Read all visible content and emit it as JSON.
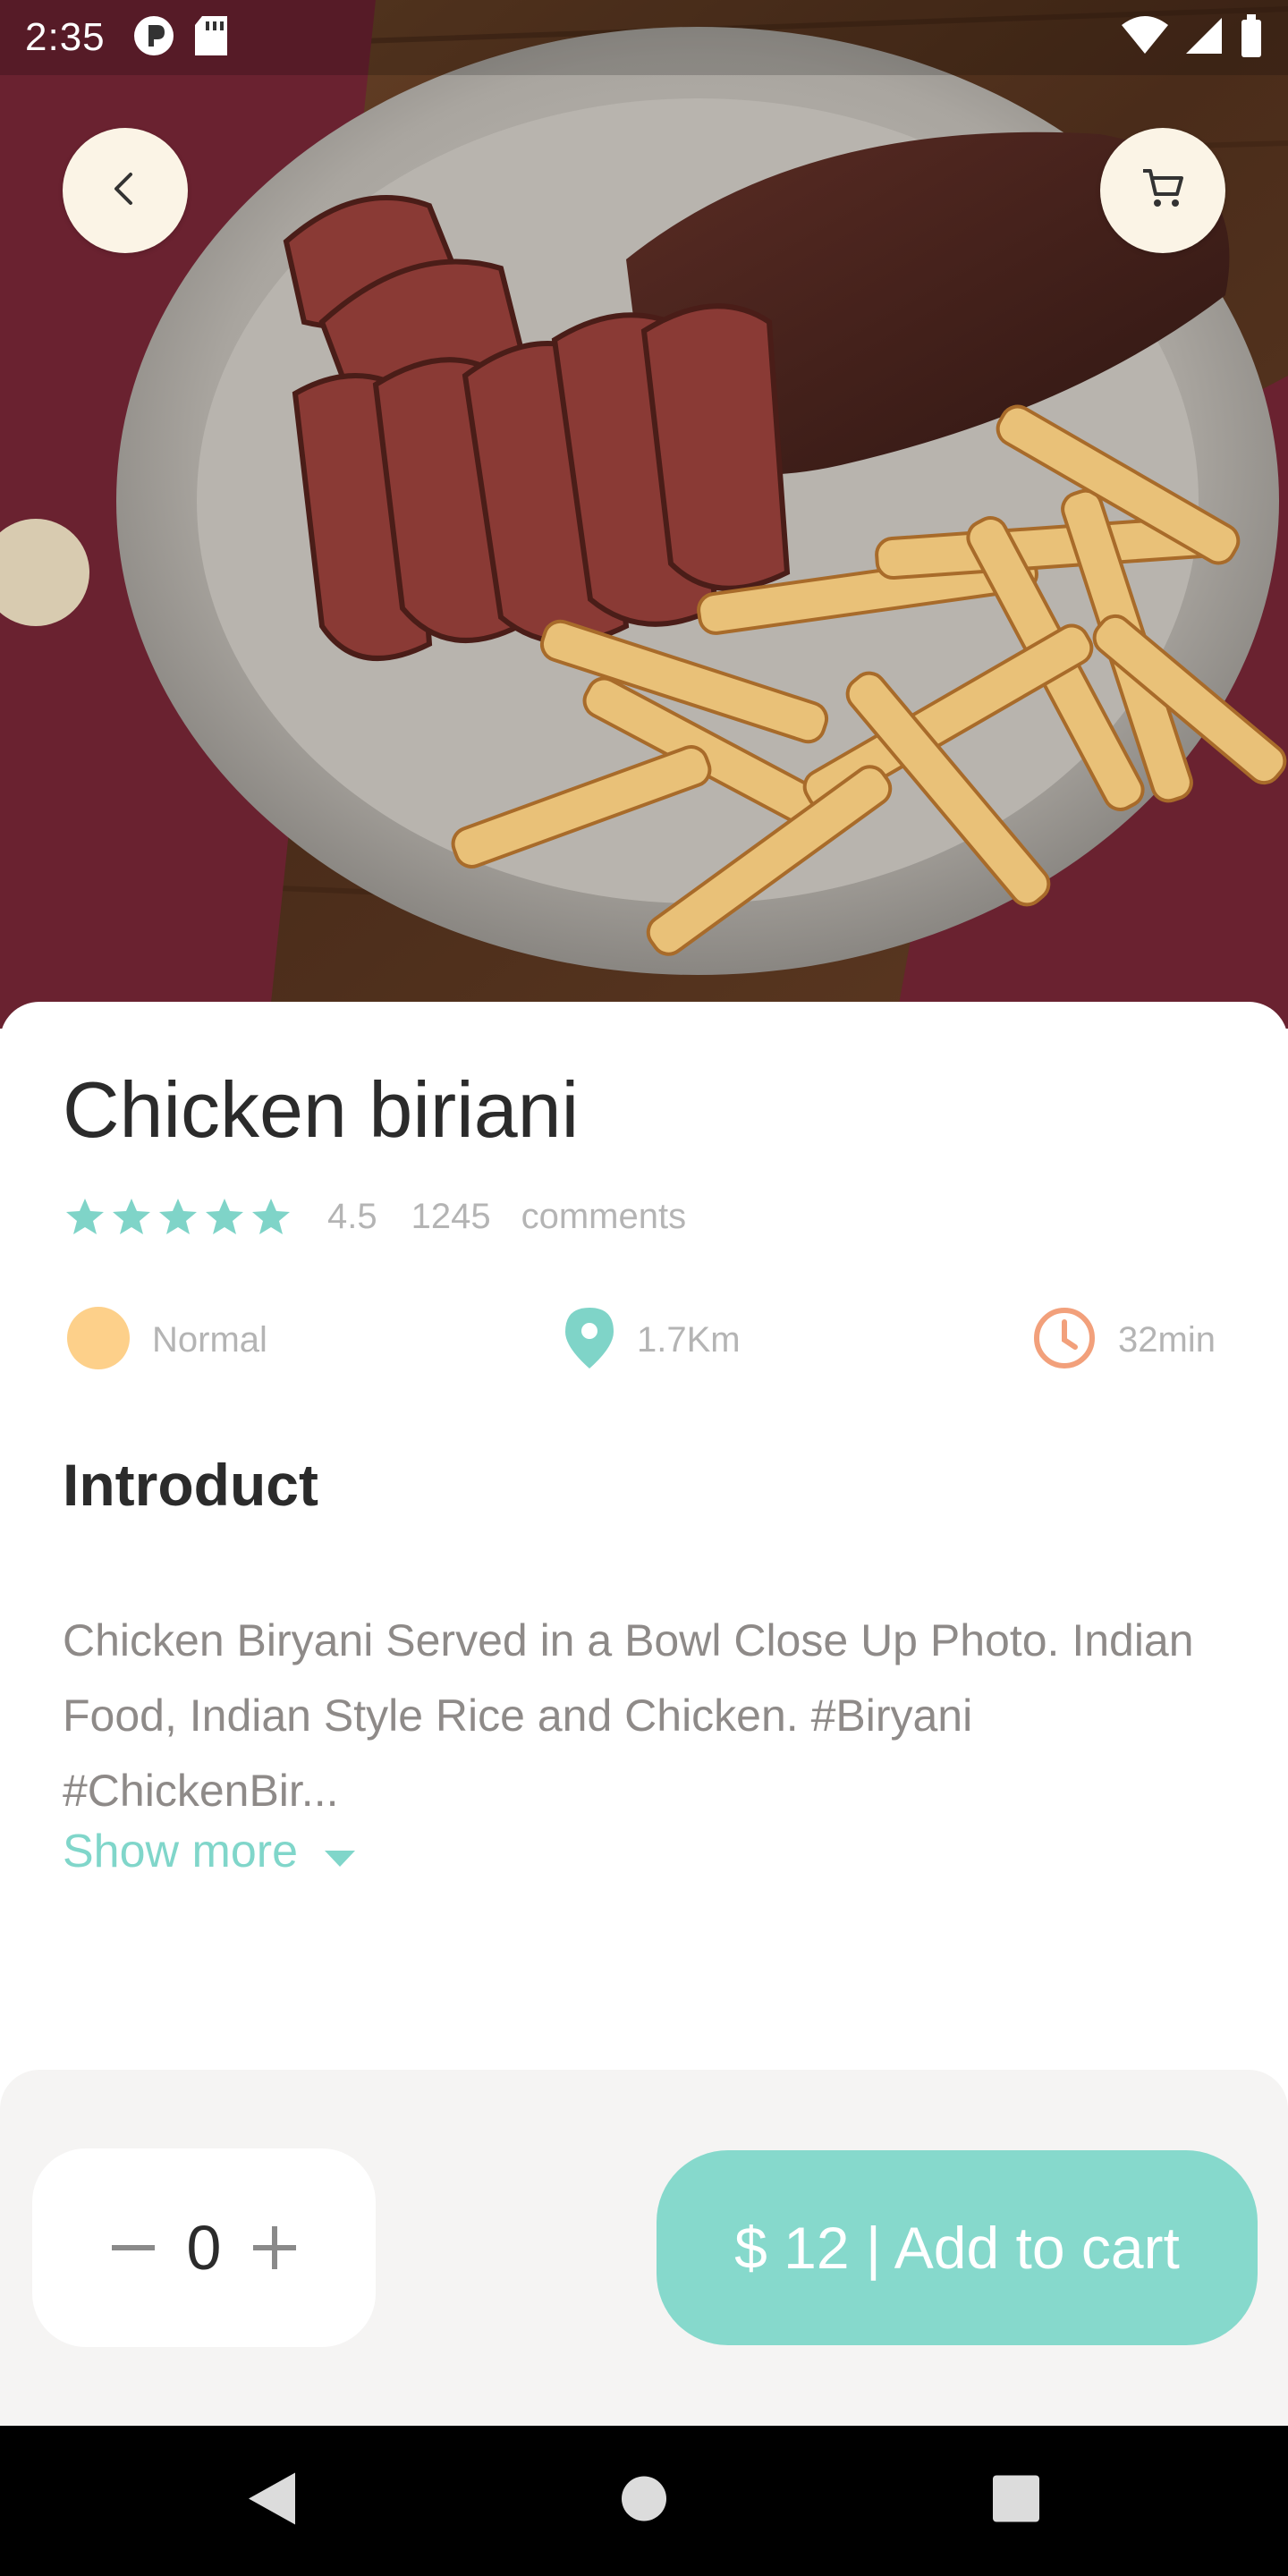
{
  "status_bar": {
    "time": "2:35"
  },
  "hero": {
    "image_alt": "",
    "back_icon": "chevron-left-icon",
    "cart_icon": "shopping-cart-icon"
  },
  "dish": {
    "name": "Chicken biriani",
    "rating": "4.5",
    "rating_value": 4.5,
    "stars_max": 5,
    "review_count": "1245",
    "comments_label": "comments"
  },
  "info": {
    "difficulty": "Normal",
    "distance": "1.7Km",
    "time": "32min"
  },
  "intro": {
    "heading": "Introduct",
    "text": "Chicken Biryani Served in a Bowl Close Up Photo. Indian Food, Indian Style Rice and Chicken. #Biryani #ChickenBir...",
    "show_more": "Show more"
  },
  "order": {
    "quantity": "0",
    "add_to_cart_label": "$ 12 | Add to cart"
  },
  "colors": {
    "accent": "#86d9cc",
    "star": "#7fd4c8",
    "difficulty_dot": "#fdd08a",
    "clock": "#f2a07b",
    "title": "#2b2b2b",
    "muted": "#b4b4b4"
  }
}
